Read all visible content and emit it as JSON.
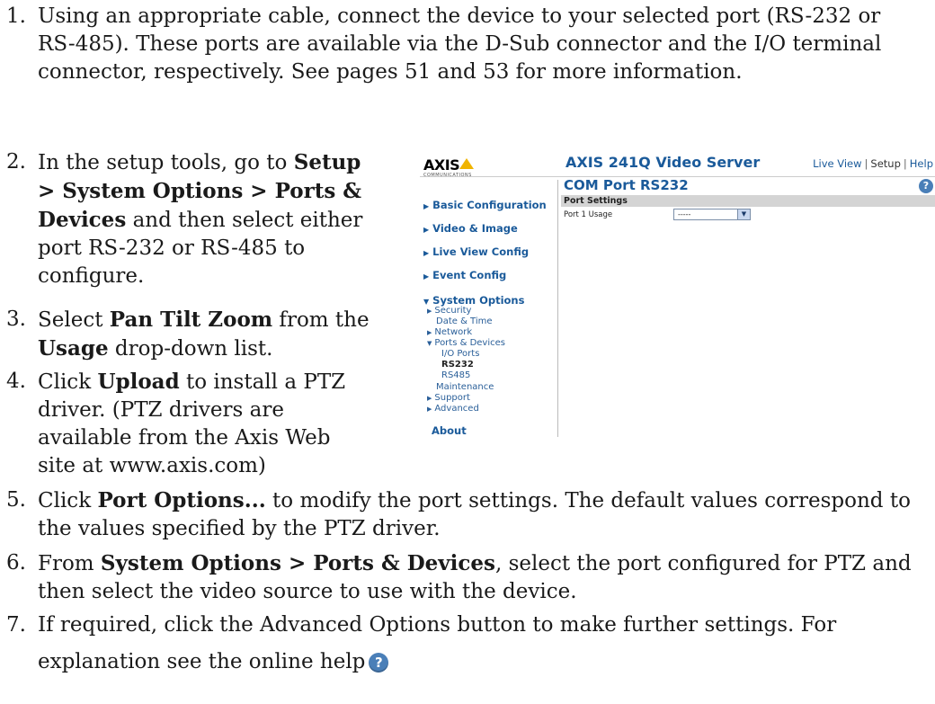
{
  "steps": [
    {
      "num": "1.",
      "lines": [
        "Using an appropriate cable, connect the device to your selected port (RS-232 or",
        "RS-485). These ports are available via the D-Sub connector and the I/O terminal",
        "connector, respectively. See pages 51 and 53 for more information."
      ]
    },
    {
      "num": "2.",
      "pre": "In the setup tools, go to ",
      "b1": "Setup",
      "b2": "> System Options > Ports &",
      "b3": "Devices",
      "post1": " and then select either",
      "l4": "port RS-232 or RS-485 to",
      "l5": "configure."
    },
    {
      "num": "3.",
      "pre": "Select ",
      "b1": "Pan Tilt Zoom",
      "post1": " from the",
      "b2": "Usage",
      "post2": " drop-down list."
    },
    {
      "num": "4.",
      "pre": "Click ",
      "b1": "Upload",
      "post1": " to install a PTZ",
      "l2": "driver. (PTZ drivers are",
      "l3": "available from the Axis Web",
      "l4": "site at www.axis.com)"
    },
    {
      "num": "5.",
      "pre": "Click ",
      "b1": "Port Options...",
      "post1": " to modify the port settings. The default values correspond to",
      "l2": "the values specified by the PTZ driver."
    },
    {
      "num": "6.",
      "pre": "From ",
      "b1": "System Options > Ports & Devices",
      "post1": ", select the port configured for PTZ and",
      "l2": "then select the video source to use with the device."
    },
    {
      "num": "7.",
      "l1": "If required, click the Advanced Options button to make further settings. For",
      "l2": "explanation see the online help",
      "help_glyph": "?"
    }
  ],
  "screenshot": {
    "logo": "AXIS",
    "logo_sub": "COMMUNICATIONS",
    "product_title": "AXIS 241Q Video Server",
    "toplinks": {
      "live_view": "Live View",
      "sep": "|",
      "setup": "Setup",
      "help": "Help"
    },
    "menu": {
      "basic": "Basic Configuration",
      "video": "Video & Image",
      "liveview": "Live View Config",
      "event": "Event Config",
      "system": "System Options",
      "security": "Security",
      "datetime": "Date & Time",
      "network": "Network",
      "ports": "Ports & Devices",
      "ioports": "I/O Ports",
      "rs232": "RS232",
      "rs485": "RS485",
      "maintenance": "Maintenance",
      "support": "Support",
      "advanced": "Advanced",
      "about": "About"
    },
    "page_heading": "COM Port RS232",
    "help_glyph": "?",
    "section": "Port Settings",
    "field_label": "Port 1 Usage",
    "select_value": "-----",
    "select_arrow": "▼",
    "icons": {
      "collapsed": "▶",
      "expanded": "▼"
    }
  }
}
